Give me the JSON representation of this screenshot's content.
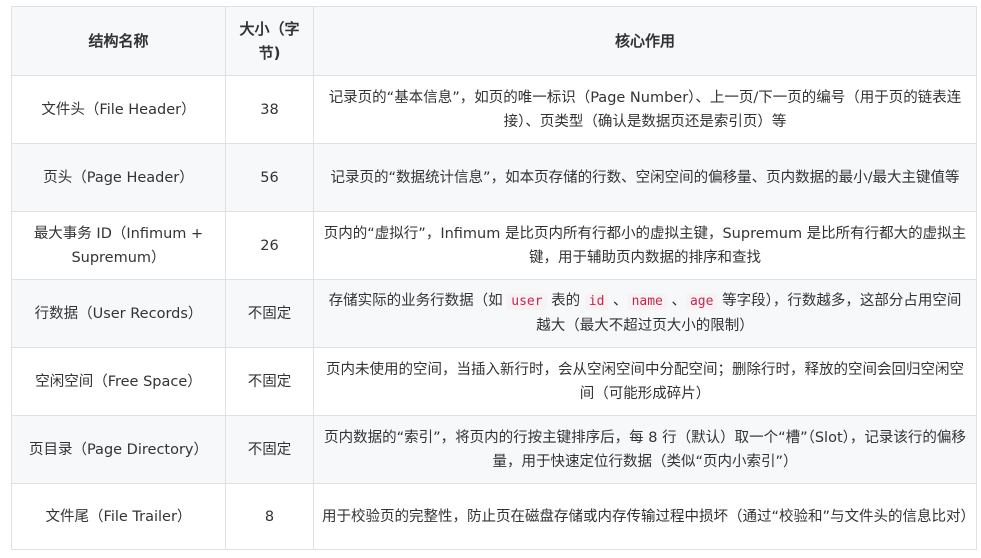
{
  "table": {
    "headers": [
      "结构名称",
      "大小（字节)",
      "核心作用"
    ],
    "rows": [
      {
        "name": "文件头（File Header）",
        "size": "38",
        "desc": "记录页的“基本信息”，如页的唯一标识（Page Number）、上一页/下一页的编号（用于页的链表连接）、页类型（确认是数据页还是索引页）等"
      },
      {
        "name": "页头（Page Header）",
        "size": "56",
        "desc": "记录页的“数据统计信息”，如本页存储的行数、空闲空间的偏移量、页内数据的最小/最大主键值等"
      },
      {
        "name": "最大事务 ID（Infimum + Supremum）",
        "size": "26",
        "desc": "页内的“虚拟行”，Infimum 是比页内所有行都小的虚拟主键，Supremum 是比所有行都大的虚拟主键，用于辅助页内数据的排序和查找"
      },
      {
        "name": "行数据（User Records）",
        "size": "不固定",
        "desc_parts": {
          "p1": "存储实际的业务行数据（如 ",
          "c1": "user",
          "p2": " 表的 ",
          "c2": "id",
          "p3": " 、",
          "c3": "name",
          "p4": " 、",
          "c4": "age",
          "p5": " 等字段），行数越多，这部分占用空间越大（最大不超过页大小的限制）"
        }
      },
      {
        "name": "空闲空间（Free Space）",
        "size": "不固定",
        "desc": "页内未使用的空间，当插入新行时，会从空闲空间中分配空间；删除行时，释放的空间会回归空闲空间（可能形成碎片）"
      },
      {
        "name": "页目录（Page Directory）",
        "size": "不固定",
        "desc": "页内数据的“索引”，将页内的行按主键排序后，每 8 行（默认）取一个“槽”（Slot），记录该行的偏移量，用于快速定位行数据（类似“页内小索引”）"
      },
      {
        "name": "文件尾（File Trailer）",
        "size": "8",
        "desc": "用于校验页的完整性，防止页在磁盘存储或内存传输过程中损坏（通过“校验和”与文件头的信息比对）"
      }
    ]
  },
  "colors": {
    "border": "#dfe2e5",
    "header_bg": "#f6f8fa",
    "stripe_bg": "#f6f8fa",
    "code_text": "#c7254e",
    "code_bg": "#f9f2f4",
    "text": "#333333"
  }
}
